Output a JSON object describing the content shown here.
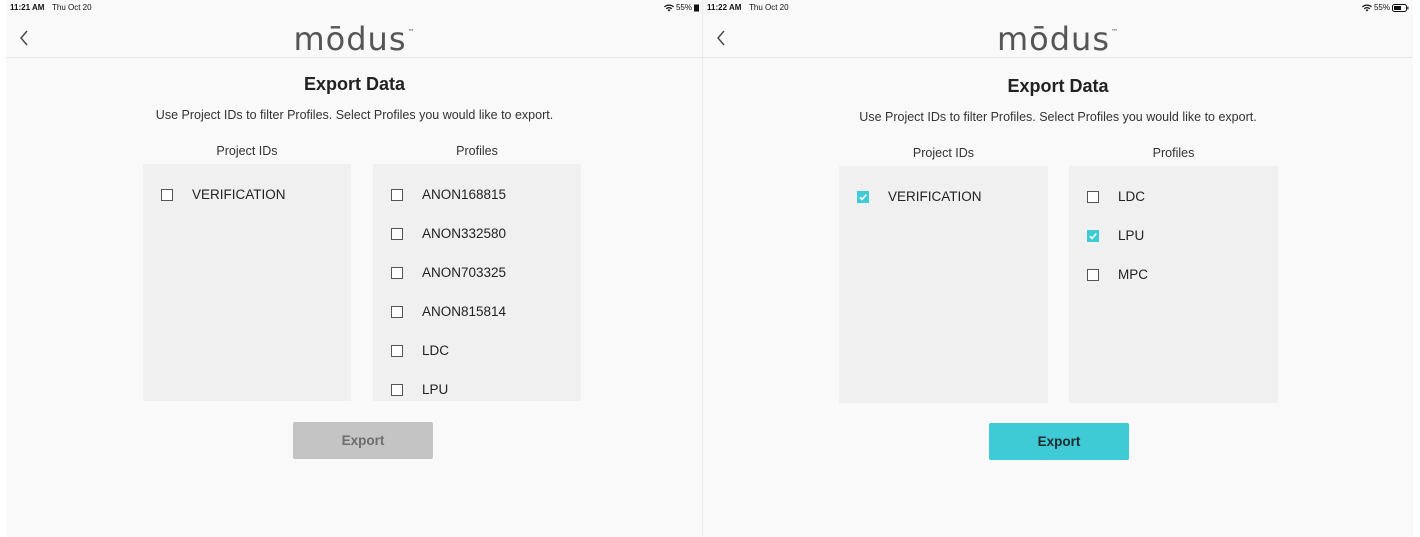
{
  "left": {
    "status": {
      "time": "11:21 AM",
      "date": "Thu Oct 20",
      "battery": "55%"
    },
    "brand": "mōdus",
    "trademark": "™",
    "title": "Export Data",
    "instructions": "Use Project IDs to filter Profiles. Select Profiles you would like to export.",
    "project_ids_label": "Project IDs",
    "profiles_label": "Profiles",
    "project_ids": [
      {
        "label": "VERIFICATION",
        "checked": false
      }
    ],
    "profiles": [
      {
        "label": "ANON168815",
        "checked": false
      },
      {
        "label": "ANON332580",
        "checked": false
      },
      {
        "label": "ANON703325",
        "checked": false
      },
      {
        "label": "ANON815814",
        "checked": false
      },
      {
        "label": "LDC",
        "checked": false
      },
      {
        "label": "LPU",
        "checked": false
      }
    ],
    "export_label": "Export",
    "export_enabled": false
  },
  "right": {
    "status": {
      "time": "11:22 AM",
      "date": "Thu Oct 20",
      "battery": "55%"
    },
    "brand": "mōdus",
    "trademark": "™",
    "title": "Export Data",
    "instructions": "Use Project IDs to filter Profiles. Select Profiles you would like to export.",
    "project_ids_label": "Project IDs",
    "profiles_label": "Profiles",
    "project_ids": [
      {
        "label": "VERIFICATION",
        "checked": true
      }
    ],
    "profiles": [
      {
        "label": "LDC",
        "checked": false
      },
      {
        "label": "LPU",
        "checked": true
      },
      {
        "label": "MPC",
        "checked": false
      }
    ],
    "export_label": "Export",
    "export_enabled": true
  },
  "colors": {
    "accent": "#3ecbd6",
    "panel": "#f0f0f0",
    "disabled": "#c4c4c4"
  },
  "icons": {
    "back": "chevron-left-icon",
    "wifi": "wifi-icon",
    "battery": "battery-icon",
    "check": "checkmark-icon"
  }
}
